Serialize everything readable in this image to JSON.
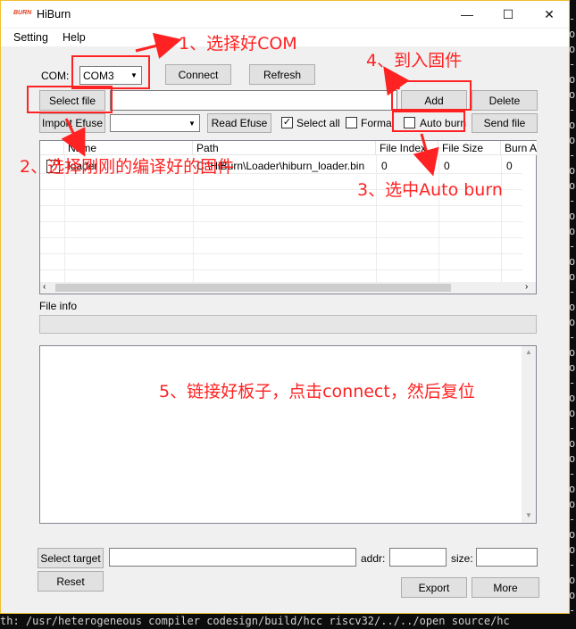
{
  "window": {
    "title": "HiBurn",
    "icon_text": "BURN"
  },
  "title_buttons": {
    "minimize": "—",
    "maximize": "☐",
    "close": "✕"
  },
  "menu": [
    "Setting",
    "Help"
  ],
  "com": {
    "label": "COM:",
    "value": "COM3"
  },
  "buttons": {
    "connect": "Connect",
    "refresh": "Refresh",
    "select_file": "Select file",
    "add": "Add",
    "delete": "Delete",
    "import_efuse": "Import Efuse",
    "read_efuse": "Read Efuse",
    "send_file": "Send file",
    "select_target": "Select target",
    "reset": "Reset",
    "export": "Export",
    "more": "More"
  },
  "checkboxes": {
    "select_all": {
      "label": "Select all",
      "checked": true
    },
    "formal": {
      "label": "Formal",
      "checked": false
    },
    "auto_burn": {
      "label": "Auto burn",
      "checked": false
    }
  },
  "table": {
    "columns": [
      "Name",
      "Path",
      "File Index",
      "File Size",
      "Burn A"
    ],
    "rows": [
      {
        "checked": true,
        "name": "loader",
        "path": "C:\\HiBurn\\Loader\\hiburn_loader.bin",
        "file_index": "0",
        "file_size": "0",
        "burn_addr": "0"
      }
    ]
  },
  "file_info_label": "File info",
  "target": {
    "addr_label": "addr:",
    "size_label": "size:"
  },
  "annotations": {
    "step1": "1、选择好COM",
    "step2": "2、选择刚刚的编译好的固件",
    "step3": "3、选中Auto burn",
    "step4": "4、到入固件",
    "step5": "5、链接好板子，点击connect，然后复位"
  },
  "terminal": {
    "bottom_line": "th: /usr/heterogeneous compiler codesign/build/hcc riscv32/../../open source/hc"
  },
  "colors": {
    "annotation": "#ff2222",
    "window_border": "#f0c030"
  }
}
